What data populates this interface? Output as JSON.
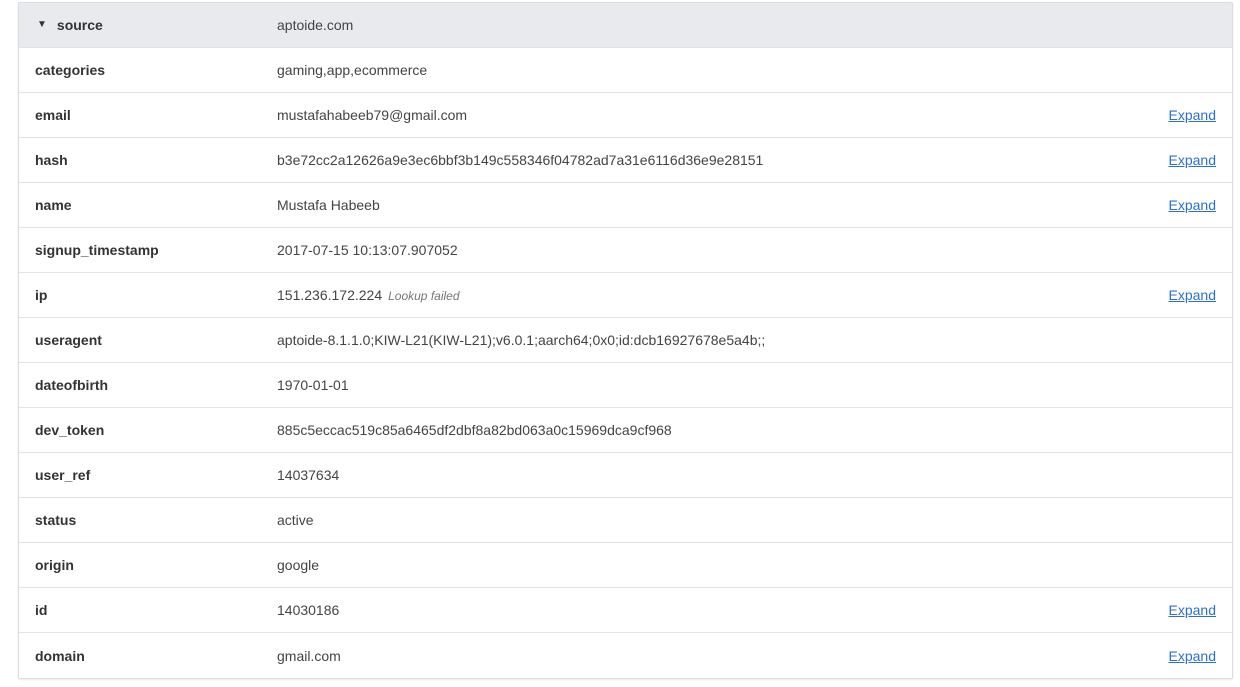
{
  "header": {
    "key": "source",
    "value": "aptoide.com",
    "toggle_icon": "triangle-down-icon"
  },
  "expand_label": "Expand",
  "rows": [
    {
      "key": "categories",
      "value": "gaming,app,ecommerce",
      "expand": false
    },
    {
      "key": "email",
      "value": "mustafahabeeb79@gmail.com",
      "expand": true
    },
    {
      "key": "hash",
      "value": "b3e72cc2a12626a9e3ec6bbf3b149c558346f04782ad7a31e6116d36e9e28151",
      "expand": true
    },
    {
      "key": "name",
      "value": "Mustafa Habeeb",
      "expand": true
    },
    {
      "key": "signup_timestamp",
      "value": "2017-07-15 10:13:07.907052",
      "expand": false
    },
    {
      "key": "ip",
      "value": "151.236.172.224",
      "note": "Lookup failed",
      "expand": true
    },
    {
      "key": "useragent",
      "value": "aptoide-8.1.1.0;KIW-L21(KIW-L21);v6.0.1;aarch64;0x0;id:dcb16927678e5a4b;;",
      "expand": false
    },
    {
      "key": "dateofbirth",
      "value": "1970-01-01",
      "expand": false
    },
    {
      "key": "dev_token",
      "value": "885c5eccac519c85a6465df2dbf8a82bd063a0c15969dca9cf968",
      "expand": false
    },
    {
      "key": "user_ref",
      "value": "14037634",
      "expand": false
    },
    {
      "key": "status",
      "value": "active",
      "expand": false
    },
    {
      "key": "origin",
      "value": "google",
      "expand": false
    },
    {
      "key": "id",
      "value": "14030186",
      "expand": true
    },
    {
      "key": "domain",
      "value": "gmail.com",
      "expand": true
    }
  ]
}
